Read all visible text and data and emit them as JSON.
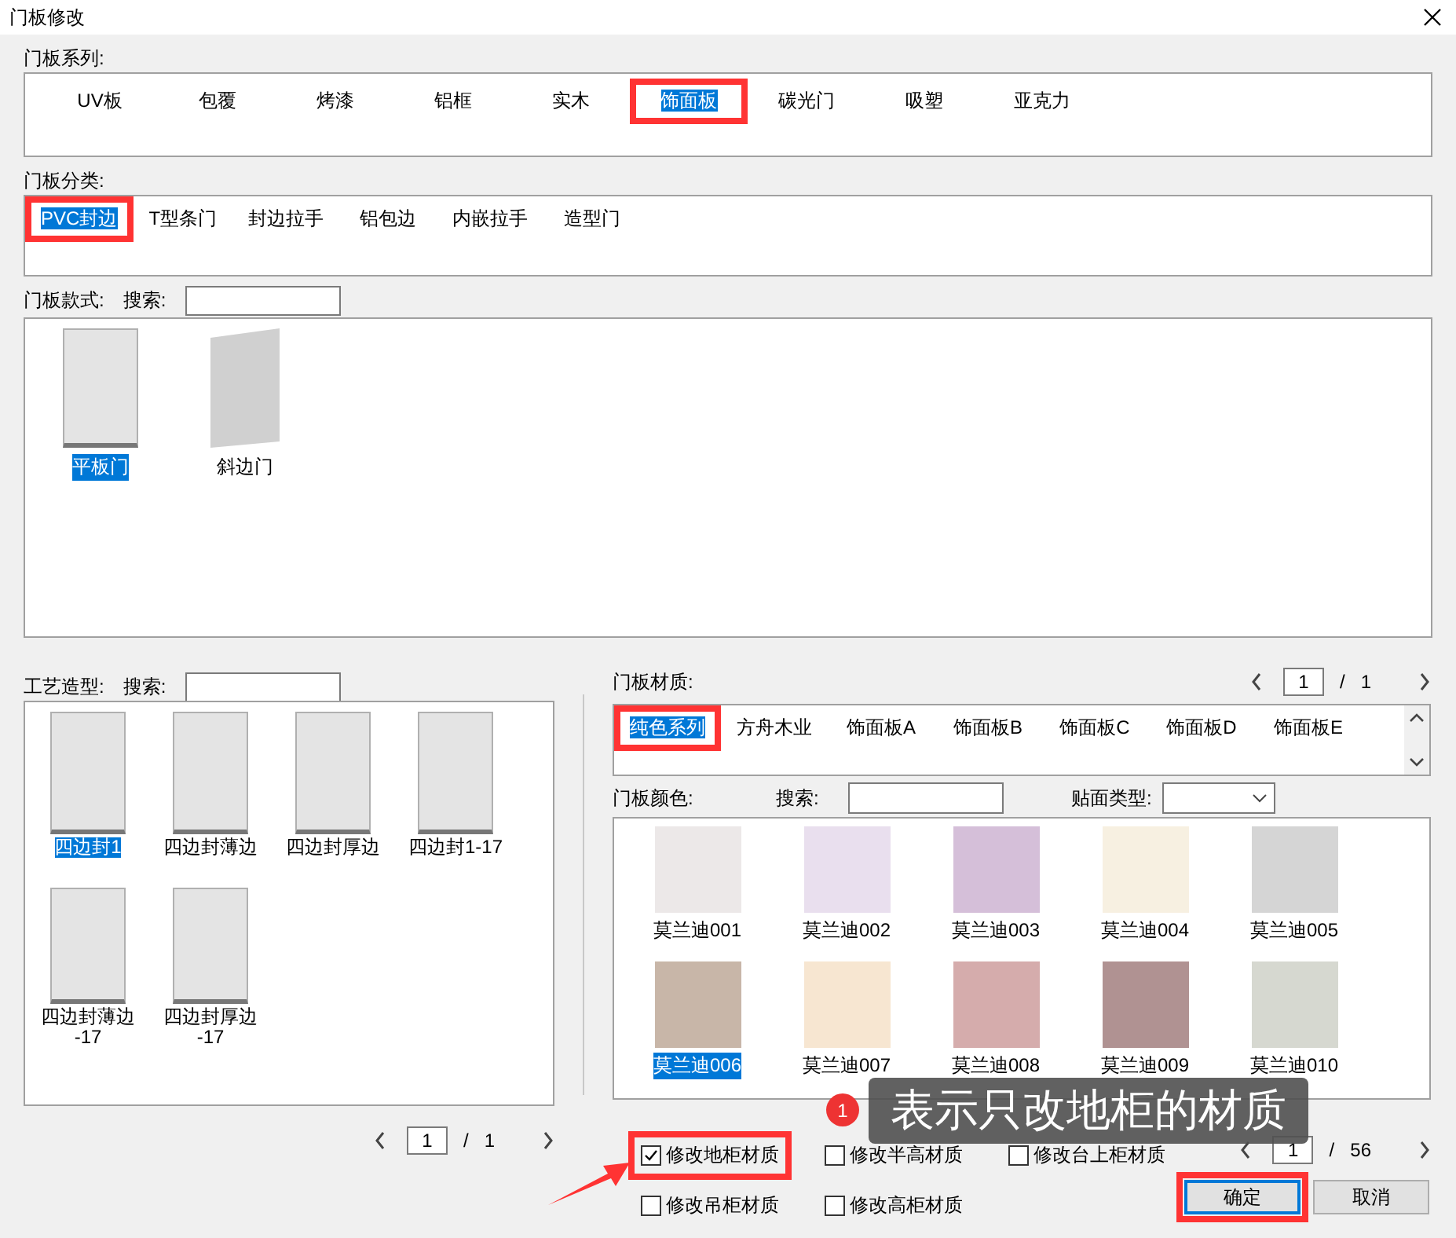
{
  "window": {
    "title": "门板修改"
  },
  "series": {
    "label": "门板系列:",
    "items": [
      {
        "label": "UV板",
        "selected": false
      },
      {
        "label": "包覆",
        "selected": false
      },
      {
        "label": "烤漆",
        "selected": false
      },
      {
        "label": "铝框",
        "selected": false
      },
      {
        "label": "实木",
        "selected": false
      },
      {
        "label": "饰面板",
        "selected": true
      },
      {
        "label": "碳光门",
        "selected": false
      },
      {
        "label": "吸塑",
        "selected": false
      },
      {
        "label": "亚克力",
        "selected": false
      }
    ]
  },
  "category": {
    "label": "门板分类:",
    "items": [
      {
        "label": "PVC封边",
        "selected": true
      },
      {
        "label": "T型条门",
        "selected": false
      },
      {
        "label": "封边拉手",
        "selected": false
      },
      {
        "label": "铝包边",
        "selected": false
      },
      {
        "label": "内嵌拉手",
        "selected": false
      },
      {
        "label": "造型门",
        "selected": false
      }
    ]
  },
  "style": {
    "label": "门板款式:",
    "search_label": "搜索:",
    "items": [
      {
        "label": "平板门",
        "kind": "flat",
        "selected": true
      },
      {
        "label": "斜边门",
        "kind": "bevel",
        "selected": false
      }
    ]
  },
  "craft": {
    "label": "工艺造型:",
    "search_label": "搜索:",
    "items": [
      {
        "label": "四边封1",
        "selected": true
      },
      {
        "label": "四边封薄边",
        "selected": false
      },
      {
        "label": "四边封厚边",
        "selected": false
      },
      {
        "label": "四边封1-17",
        "selected": false
      },
      {
        "label": "四边封薄边\n-17",
        "selected": false
      },
      {
        "label": "四边封厚边\n-17",
        "selected": false
      }
    ],
    "pager": {
      "page": "1",
      "separator": "/",
      "total": "1"
    }
  },
  "material": {
    "label": "门板材质:",
    "pager": {
      "page": "1",
      "separator": "/",
      "total": "1"
    },
    "tabs": [
      {
        "label": "纯色系列",
        "selected": true
      },
      {
        "label": "方舟木业",
        "selected": false
      },
      {
        "label": "饰面板A",
        "selected": false
      },
      {
        "label": "饰面板B",
        "selected": false
      },
      {
        "label": "饰面板C",
        "selected": false
      },
      {
        "label": "饰面板D",
        "selected": false
      },
      {
        "label": "饰面板E",
        "selected": false
      }
    ]
  },
  "color": {
    "label": "门板颜色:",
    "search_label": "搜索:",
    "type_label": "贴面类型:",
    "swatches": [
      {
        "label": "莫兰迪001",
        "color": "#ece8e8",
        "selected": false
      },
      {
        "label": "莫兰迪002",
        "color": "#e9dfee",
        "selected": false
      },
      {
        "label": "莫兰迪003",
        "color": "#d5bfd9",
        "selected": false
      },
      {
        "label": "莫兰迪004",
        "color": "#f7f0e1",
        "selected": false
      },
      {
        "label": "莫兰迪005",
        "color": "#d5d5d5",
        "selected": false
      },
      {
        "label": "莫兰迪006",
        "color": "#c8b6a8",
        "selected": true
      },
      {
        "label": "莫兰迪007",
        "color": "#f7e6d1",
        "selected": false
      },
      {
        "label": "莫兰迪008",
        "color": "#d5acac",
        "selected": false
      },
      {
        "label": "莫兰迪009",
        "color": "#b09292",
        "selected": false
      },
      {
        "label": "莫兰迪010",
        "color": "#d6d8d0",
        "selected": false
      }
    ],
    "pager": {
      "page": "1",
      "separator": "/",
      "total": "56"
    }
  },
  "options": [
    {
      "label": "修改地柜材质",
      "checked": true,
      "highlighted": true
    },
    {
      "label": "修改半高材质",
      "checked": false,
      "highlighted": false
    },
    {
      "label": "修改台上柜材质",
      "checked": false,
      "highlighted": false
    },
    {
      "label": "修改吊柜材质",
      "checked": false,
      "highlighted": false
    },
    {
      "label": "修改高柜材质",
      "checked": false,
      "highlighted": false
    }
  ],
  "buttons": [
    {
      "label": "确定",
      "kind": "primary",
      "highlighted": true
    },
    {
      "label": "取消",
      "kind": "normal",
      "highlighted": false
    }
  ],
  "callout": {
    "badge": "1",
    "text": "表示只改地柜的材质"
  }
}
